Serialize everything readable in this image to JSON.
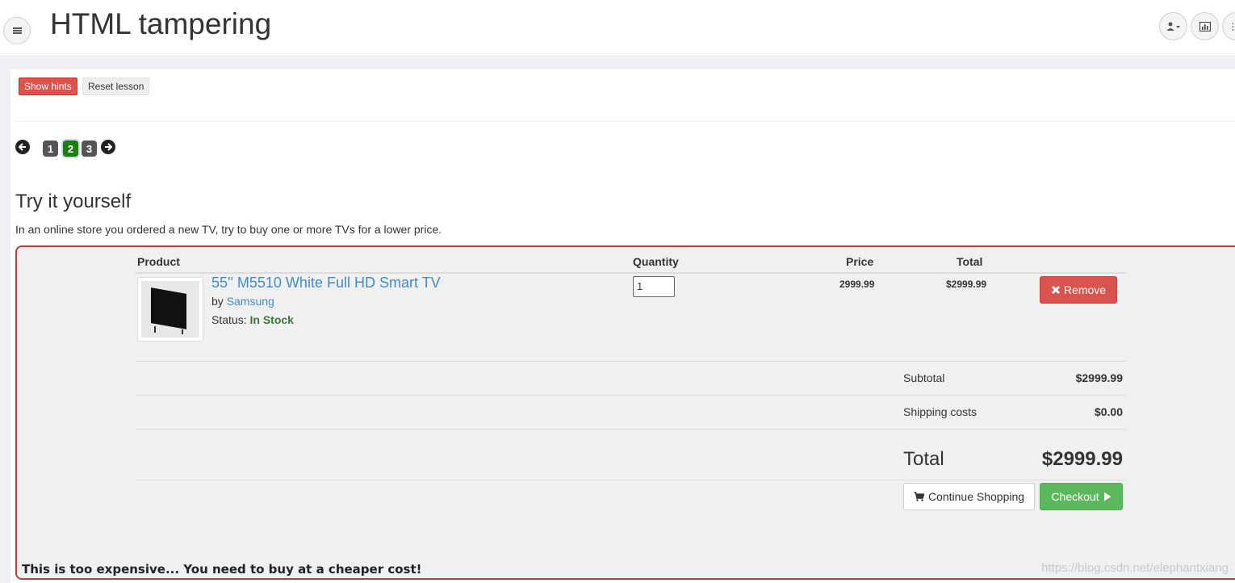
{
  "header": {
    "title": "HTML tampering",
    "menu_icon": "hamburger-icon",
    "right_icons": [
      "user-dropdown-icon",
      "bar-chart-icon",
      "more-icon"
    ]
  },
  "toolbar": {
    "show_hints_label": "Show hints",
    "reset_lesson_label": "Reset lesson"
  },
  "pagination": {
    "pages": [
      "1",
      "2",
      "3"
    ],
    "active_page": "2"
  },
  "lesson": {
    "title": "Try it yourself",
    "description": "In an online store you ordered a new TV, try to buy one or more TVs for a lower price."
  },
  "cart": {
    "columns": [
      "Product",
      "Quantity",
      "Price",
      "Total"
    ],
    "item": {
      "name": "55'' M5510 White Full HD Smart TV",
      "by_prefix": "by",
      "brand": "Samsung",
      "status_prefix": "Status:",
      "status": "In Stock",
      "quantity": "1",
      "price": "2999.99",
      "total": "$2999.99",
      "remove_label": "Remove"
    },
    "subtotal_label": "Subtotal",
    "subtotal_value": "$2999.99",
    "shipping_label": "Shipping costs",
    "shipping_value": "$0.00",
    "total_label": "Total",
    "total_value": "$2999.99",
    "continue_label": "Continue Shopping",
    "checkout_label": "Checkout"
  },
  "feedback": "This is too expensive... You need to buy at a cheaper cost!",
  "watermark": "https://blog.csdn.net/elephantxiang",
  "colors": {
    "danger": "#d9534f",
    "success": "#5cb85c",
    "link": "#428bca",
    "in_stock": "#3c763d",
    "active_page": "#1e7d12"
  }
}
